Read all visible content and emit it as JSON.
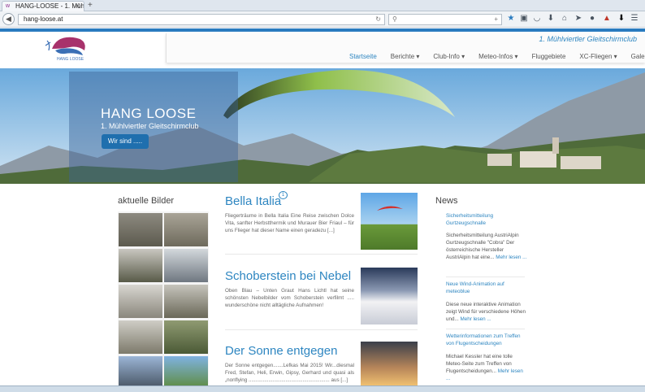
{
  "browser": {
    "tab_title": "HANG-LOOSE - 1. Mühlvie...",
    "url": "hang-loose.at",
    "search_placeholder": "",
    "toolbar_icons": [
      "star-icon",
      "clipboard-icon",
      "pocket-icon",
      "download-icon",
      "home-icon",
      "send-icon",
      "chat-icon",
      "addon-icon",
      "arrow-down-icon",
      "menu-icon"
    ]
  },
  "site": {
    "tagline": "1. Mühlviertler Gleitschirmclub",
    "menu": [
      {
        "label": "Startseite",
        "active": true
      },
      {
        "label": "Berichte ▾",
        "active": false
      },
      {
        "label": "Club-Info ▾",
        "active": false
      },
      {
        "label": "Meteo-Infos ▾",
        "active": false
      },
      {
        "label": "Fluggebiete",
        "active": false
      },
      {
        "label": "XC-Fliegen ▾",
        "active": false
      },
      {
        "label": "Galerie ▾",
        "active": false
      }
    ],
    "logo_text": "HANG LOOSE"
  },
  "hero": {
    "title": "HANG LOOSE",
    "subtitle": "1. Mühlviertler Gleitschirmclub",
    "button": "Wir sind ....."
  },
  "left": {
    "title": "aktuelle Bilder"
  },
  "posts": [
    {
      "title": "Bella Italia",
      "comment_count": "1",
      "text": "Fliegerträume in Bella Italia Eine Reise zwischen Dolce Vita, sanfter Herbstthermik und Murauer Bier Friaul – für uns Flieger hat dieser Name einen geradezu [...]"
    },
    {
      "title": "Schoberstein bei Nebel",
      "text": "Oben Blau – Unten Graut Hans Lichtl hat seine schönsten Nebelbilder vom Schoberstein verfilmt ..... wunderschöne nicht alltägliche Aufnahmen!"
    },
    {
      "title": "Der Sonne entgegen",
      "text": "Der Sonne entgegen.......Lefkas Mai 2015! Wir...diesmal Fred, Stefan, Heli, Erwin, Gipsy, Gerhard und quasi als „nonflying ......................................................... aus [...]"
    }
  ],
  "news": {
    "title": "News",
    "items": [
      {
        "link": "Sicherheitsmitteilung Gurtzeugschnalle",
        "text": "Sicherheitsmitteilung AustriAlpin Gurtzeugschnalle \"Cobra\" Der österreichische Hersteller AustriAlpin hat eine...",
        "more": "Mehr lesen ..."
      },
      {
        "link": "Neue Wind-Animation auf meteoblue",
        "text": "Diese neue interaktive Animation zeigt Wind für verschiedene Höhen und...",
        "more": "Mehr lesen ..."
      },
      {
        "link": "Wetterinformationen zum Treffen von Flugentscheidungen",
        "text": "Michael Kessler hat eine tolle Meteo-Seite zum Treffen von Flugentscheidungen...",
        "more": "Mehr lesen ..."
      }
    ]
  },
  "colors": {
    "accent": "#2e86c1",
    "brand_bar": "#2a7bbf",
    "hero_button": "#1f6fae"
  }
}
